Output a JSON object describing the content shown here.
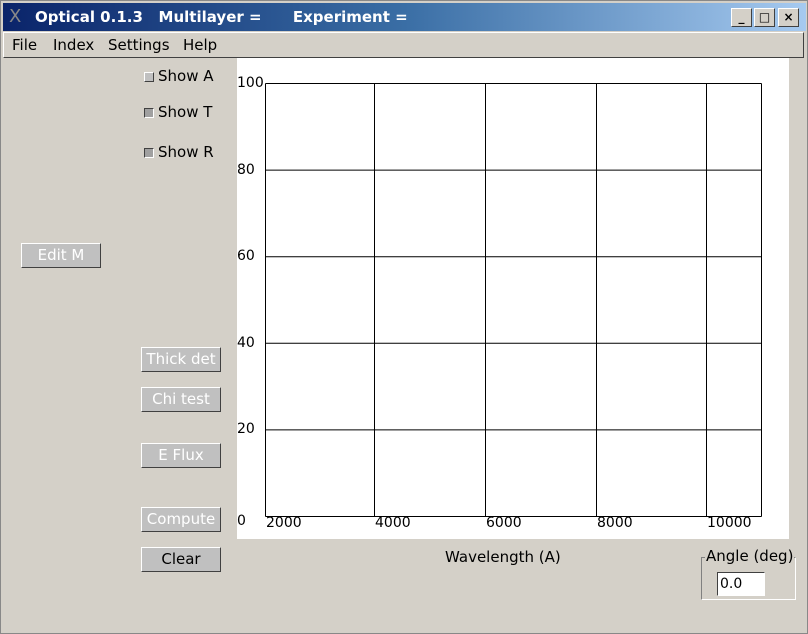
{
  "window": {
    "title": "Optical 0.1.3   Multilayer =      Experiment =",
    "logo": "X",
    "controls": [
      "_",
      "□",
      "×"
    ]
  },
  "menu": [
    "File",
    "Index",
    "Settings",
    "Help"
  ],
  "checkboxes": [
    {
      "label": "Show A",
      "checked": false
    },
    {
      "label": "Show T",
      "checked": true
    },
    {
      "label": "Show R",
      "checked": true
    }
  ],
  "buttons": {
    "edit_m": "Edit M",
    "thick_det": "Thick det",
    "chi_test": "Chi test",
    "e_flux": "E Flux",
    "compute": "Compute",
    "clear": "Clear"
  },
  "chart_data": {
    "type": "line",
    "xlabel": "Wavelength (A)",
    "ylabel": "",
    "y_ticks": [
      "100",
      "80",
      "60",
      "40",
      "20",
      "0"
    ],
    "x_ticks": [
      "2000",
      "4000",
      "6000",
      "8000",
      "10000"
    ],
    "ylim": [
      0,
      100
    ],
    "grid": true,
    "series": []
  },
  "angle": {
    "label": "Angle (deg)",
    "value": "0.0"
  }
}
